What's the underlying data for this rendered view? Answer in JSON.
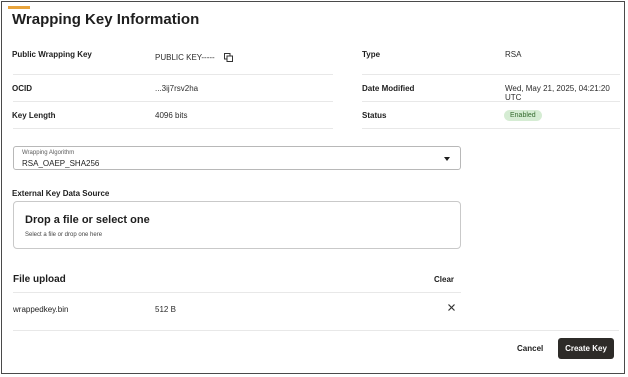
{
  "page": {
    "title": "Wrapping Key Information"
  },
  "details": {
    "public_key_label": "Public Wrapping Key",
    "public_key_value": "PUBLIC KEY-----",
    "type_label": "Type",
    "type_value": "RSA",
    "ocid_label": "OCID",
    "ocid_value": "...3ij7rsv2ha",
    "date_label": "Date Modified",
    "date_value": "Wed, May 21, 2025, 04:21:20 UTC",
    "key_length_label": "Key Length",
    "key_length_value": "4096 bits",
    "status_label": "Status",
    "status_value": "Enabled"
  },
  "algorithm": {
    "label": "Wrapping Algorithm",
    "value": "RSA_OAEP_SHA256"
  },
  "source": {
    "label": "External Key Data Source",
    "drop_title": "Drop a file or select one",
    "drop_hint": "Select a file or drop one here"
  },
  "upload": {
    "heading": "File upload",
    "clear_label": "Clear",
    "file_name": "wrappedkey.bin",
    "file_size": "512 B"
  },
  "footer": {
    "cancel_label": "Cancel",
    "create_label": "Create Key"
  },
  "colors": {
    "accent": "#e8a33b",
    "status_bg": "#d5ecd3",
    "status_text": "#356b2f",
    "primary_button": "#2d2b28"
  },
  "icons": [
    "copy-icon",
    "chevron-down-icon",
    "close-icon"
  ]
}
